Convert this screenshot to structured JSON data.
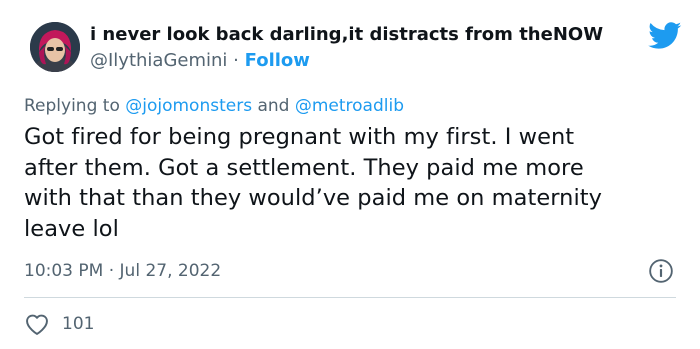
{
  "author": {
    "display_name": "i never look back darling,it distracts from theNOW",
    "handle": "@IlythiaGemini",
    "separator": "·",
    "follow_label": "Follow"
  },
  "reply": {
    "prefix": "Replying to",
    "mention_1": "@jojomonsters",
    "conjunction": "and",
    "mention_2": "@metroadlib"
  },
  "tweet": {
    "lines": [
      "Got fired for being pregnant with my first. I went",
      "after them. Got a settlement. They paid me more",
      "with that than they would’ve paid me on maternity",
      "leave lol"
    ]
  },
  "meta": {
    "time": "10:03 PM",
    "separator": "·",
    "date": "Jul 27, 2022"
  },
  "engagement": {
    "likes": "101"
  },
  "icons": {
    "brand": "twitter-bird-icon",
    "info": "info-icon",
    "like": "heart-icon"
  },
  "colors": {
    "accent": "#1d9bf0",
    "text": "#0f1419",
    "secondary": "#536471",
    "divider": "#cfd9de"
  }
}
